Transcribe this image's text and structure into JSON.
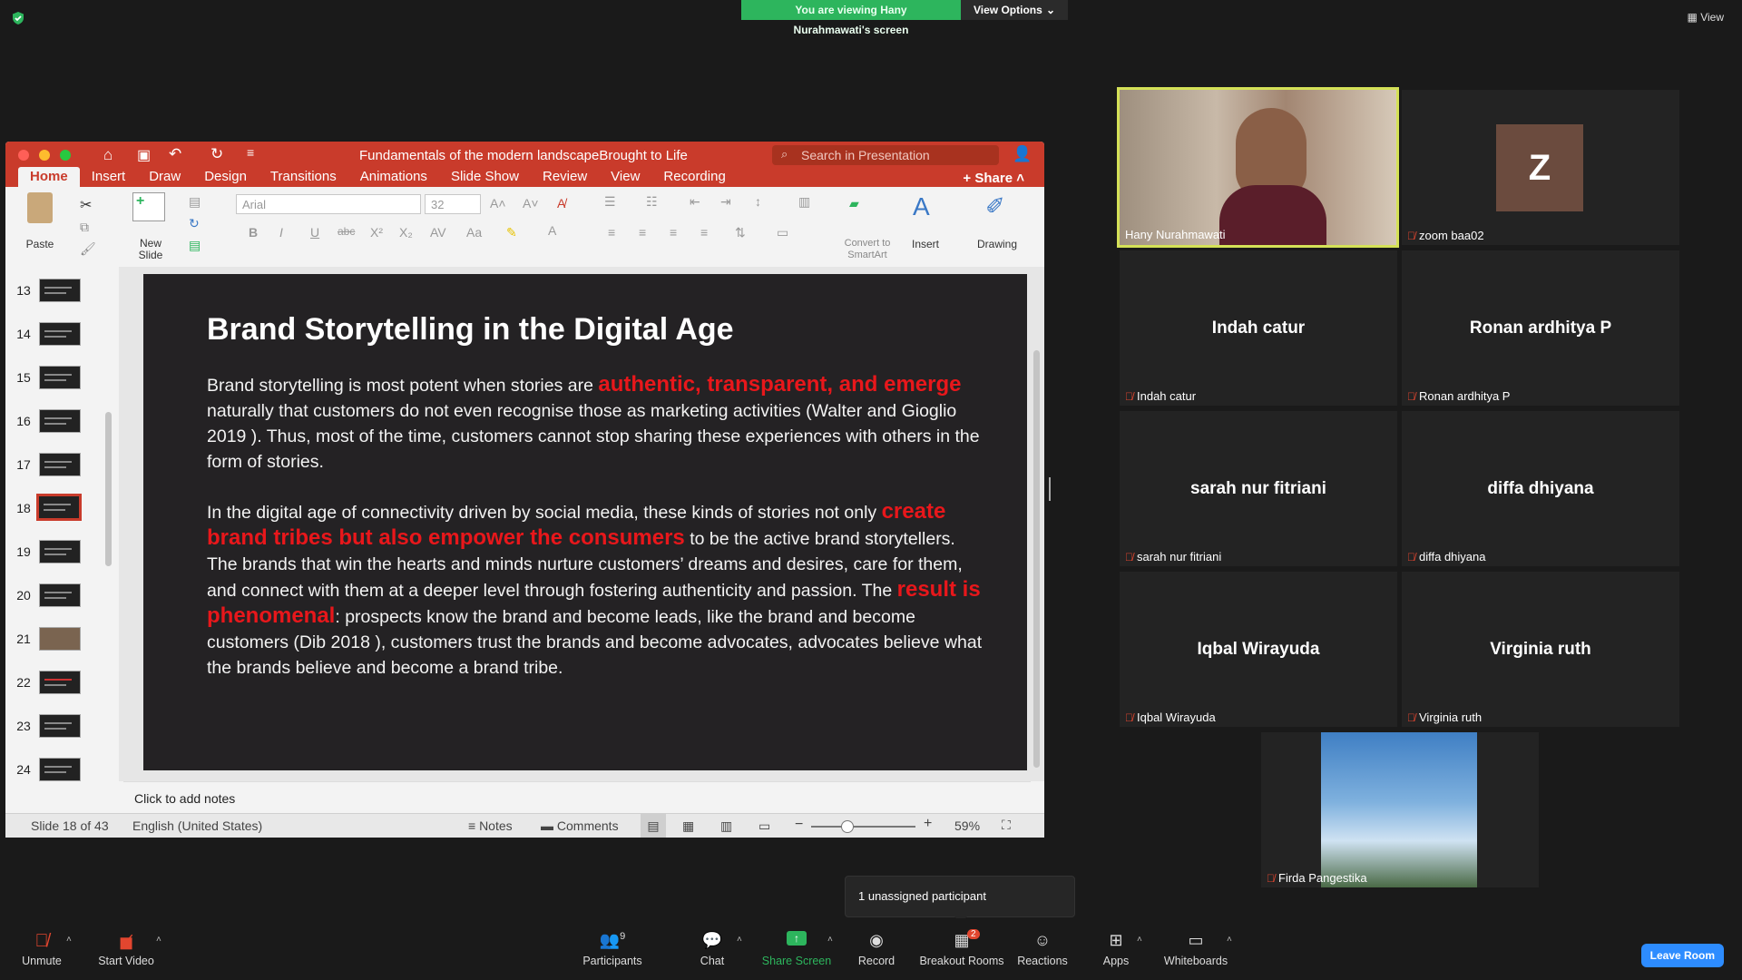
{
  "banner": {
    "viewing": "You are viewing Hany Nurahmawati's screen",
    "view_options": "View Options"
  },
  "top_right_view": "View",
  "ppt": {
    "doc_title": "Fundamentals of the modern landscapeBrought to Life",
    "search_placeholder": "Search in Presentation",
    "tabs": [
      "Home",
      "Insert",
      "Draw",
      "Design",
      "Transitions",
      "Animations",
      "Slide Show",
      "Review",
      "View",
      "Recording"
    ],
    "share": "Share",
    "ribbon": {
      "paste": "Paste",
      "new_slide": "New Slide",
      "font": "Arial",
      "size": "32",
      "convert": "Convert to SmartArt",
      "insert": "Insert",
      "drawing": "Drawing"
    },
    "thumbnails": [
      "13",
      "14",
      "15",
      "16",
      "17",
      "18",
      "19",
      "20",
      "21",
      "22",
      "23",
      "24"
    ],
    "selected_thumb": "18",
    "slide": {
      "title": "Brand Storytelling in the Digital Age",
      "p1a": "Brand storytelling is most potent when stories are ",
      "p1red": "authentic, transparent, and emerge",
      "p1b": " naturally that customers do not even recognise those as marketing activities (Walter and Gioglio 2019 ).  Thus, most of the time, customers cannot stop sharing these experiences with others in the form of stories.",
      "p2a": "In the digital age of connectivity driven by social media, these kinds of stories not only ",
      "p2red": "create brand tribes but also empower the consumers",
      "p2b": " to be the active brand storytellers. The brands that win the hearts and minds nurture customers’ dreams and desires, care for them, and connect with them at a deeper level through fostering authenticity and passion. The ",
      "p2red2": "result is phenomenal",
      "p2c": ": prospects know the brand and become leads,  like the brand and become customers (Dib 2018 ), customers trust the brands and become advocates, advocates believe what the brands believe and become a brand tribe."
    },
    "notes_placeholder": "Click to add notes",
    "status": {
      "slide": "Slide 18 of 43",
      "lang": "English (United States)",
      "notes": "Notes",
      "comments": "Comments",
      "zoom": "59%"
    }
  },
  "participants_tiles": [
    {
      "name": "Hany Nurahmawati",
      "big": "",
      "kind": "video"
    },
    {
      "name": "zoom baa02",
      "big": "Z",
      "kind": "avatar"
    },
    {
      "name": "Indah catur",
      "big": "Indah catur",
      "kind": "name"
    },
    {
      "name": "Ronan ardhitya P",
      "big": "Ronan ardhitya P",
      "kind": "name"
    },
    {
      "name": "sarah nur fitriani",
      "big": "sarah nur fitriani",
      "kind": "name"
    },
    {
      "name": "diffa dhiyana",
      "big": "diffa dhiyana",
      "kind": "name"
    },
    {
      "name": "Iqbal Wirayuda",
      "big": "Iqbal Wirayuda",
      "kind": "name"
    },
    {
      "name": "Virginia ruth",
      "big": "Virginia ruth",
      "kind": "name"
    },
    {
      "name": "Firda Pangestika",
      "big": "",
      "kind": "photo"
    }
  ],
  "tooltip": "1 unassigned participant",
  "toolbar": {
    "unmute": "Unmute",
    "start_video": "Start Video",
    "participants": "Participants",
    "participants_count": "9",
    "chat": "Chat",
    "share_screen": "Share Screen",
    "record": "Record",
    "breakout": "Breakout Rooms",
    "breakout_badge": "2",
    "reactions": "Reactions",
    "apps": "Apps",
    "whiteboards": "Whiteboards",
    "leave": "Leave Room"
  },
  "colors": {
    "accent_green": "#2db55d",
    "ppt_red": "#c93b2b",
    "zoom_blue": "#2d8cff",
    "slide_red": "#e8171b"
  }
}
